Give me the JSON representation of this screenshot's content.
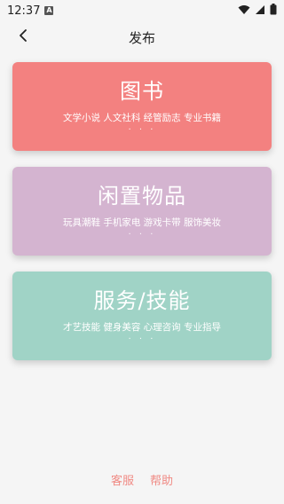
{
  "status_bar": {
    "time": "12:37",
    "notification_letter": "A"
  },
  "header": {
    "title": "发布"
  },
  "cards": [
    {
      "title": "图书",
      "subtitle": "文学小说 人文社科 经管励志 专业书籍",
      "dots": "· · ·",
      "color": "#f38180"
    },
    {
      "title": "闲置物品",
      "subtitle": "玩具潮鞋 手机家电 游戏卡带 服饰美妆",
      "dots": "· · ·",
      "color": "#d4b4d0"
    },
    {
      "title": "服务/技能",
      "subtitle": "才艺技能 健身美容 心理咨询 专业指导",
      "dots": "· · ·",
      "color": "#a0d3c6"
    }
  ],
  "footer": {
    "service_label": "客服",
    "help_label": "帮助",
    "accent_color": "#f08a84"
  },
  "icons": {
    "back": "chevron-left-icon",
    "wifi": "wifi-icon",
    "signal": "signal-icon",
    "battery": "battery-icon"
  }
}
